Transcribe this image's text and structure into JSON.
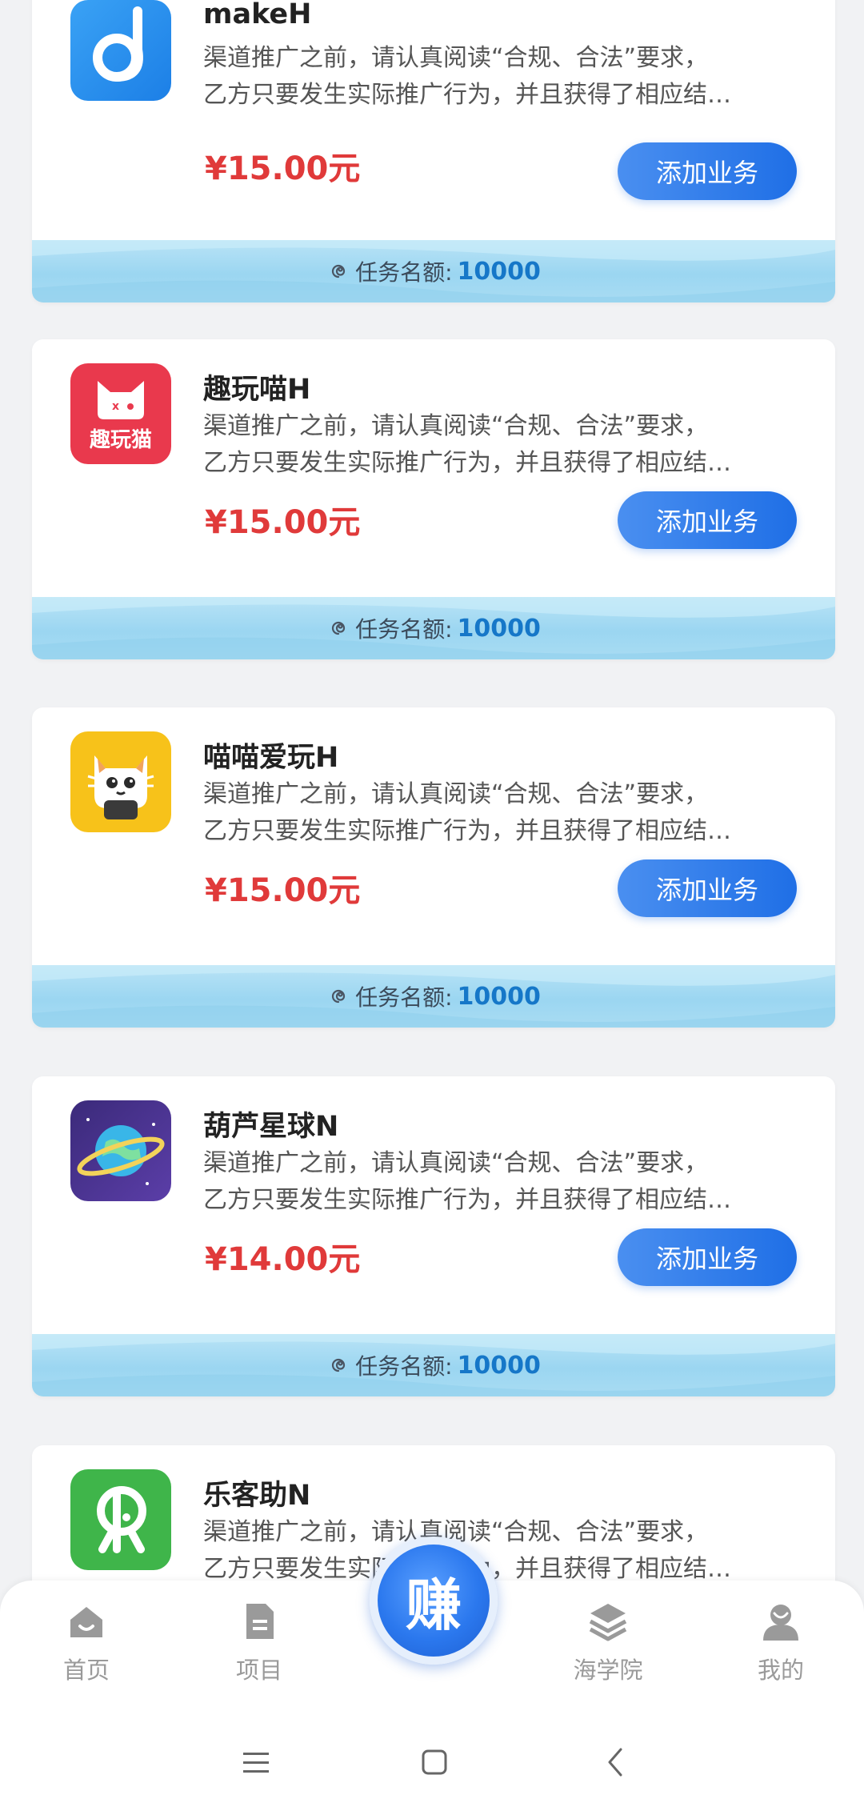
{
  "items": [
    {
      "name": "makeH",
      "desc_line1": "渠道推广之前，请认真阅读“合规、合法”要求，",
      "desc_line2": "乙方只要发生实际推广行为，并且获得了相应结…",
      "price": "¥15.00元",
      "button": "添加业务",
      "quota_label": "任务名额:",
      "quota_value": "10000",
      "icon": "makeh-app-icon"
    },
    {
      "name": "趣玩喵H",
      "desc_line1": "渠道推广之前，请认真阅读“合规、合法”要求，",
      "desc_line2": "乙方只要发生实际推广行为，并且获得了相应结…",
      "price": "¥15.00元",
      "button": "添加业务",
      "quota_label": "任务名额:",
      "quota_value": "10000",
      "icon": "quwanmiao-app-icon",
      "icon_text": "趣玩猫"
    },
    {
      "name": "喵喵爱玩H",
      "desc_line1": "渠道推广之前，请认真阅读“合规、合法”要求，",
      "desc_line2": "乙方只要发生实际推广行为，并且获得了相应结…",
      "price": "¥15.00元",
      "button": "添加业务",
      "quota_label": "任务名额:",
      "quota_value": "10000",
      "icon": "miaomiao-app-icon"
    },
    {
      "name": "葫芦星球N",
      "desc_line1": "渠道推广之前，请认真阅读“合规、合法”要求，",
      "desc_line2": "乙方只要发生实际推广行为，并且获得了相应结…",
      "price": "¥14.00元",
      "button": "添加业务",
      "quota_label": "任务名额:",
      "quota_value": "10000",
      "icon": "hulu-planet-app-icon"
    },
    {
      "name": "乐客助N",
      "desc_line1": "渠道推广之前，请认真阅读“合规、合法”要求，",
      "desc_line2": "乙方只要发生实际推广行为，并且获得了相应结…",
      "icon": "lekezhu-app-icon"
    }
  ],
  "tabbar": {
    "home": "首页",
    "projects": "项目",
    "earn": "赚",
    "academy": "海学院",
    "mine": "我的"
  },
  "colors": {
    "price": "#e03a3a",
    "button": "#2a7bea",
    "quota_value": "#1677c8"
  }
}
